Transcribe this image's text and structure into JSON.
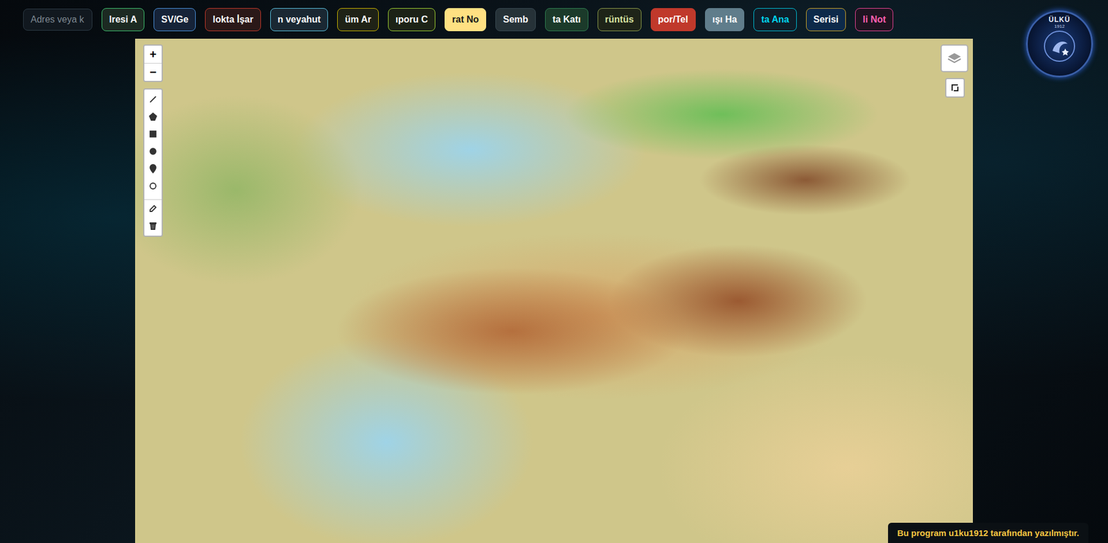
{
  "search": {
    "placeholder": "Adres veya k"
  },
  "toolbar_buttons": [
    {
      "label": "lresi A",
      "bg": "#1c2a22",
      "border": "#3fbf6f",
      "text": "#ffffff"
    },
    {
      "label": "SV/Ge",
      "bg": "#162338",
      "border": "#4a90d9",
      "text": "#ffffff"
    },
    {
      "label": "lokta İşar",
      "bg": "#2a1818",
      "border": "#c0392b",
      "text": "#ffffff"
    },
    {
      "label": "n veyahut",
      "bg": "#1a2833",
      "border": "#5bc0de",
      "text": "#ffffff"
    },
    {
      "label": "üm Ar",
      "bg": "#1f2216",
      "border": "#c8b400",
      "text": "#ffffff"
    },
    {
      "label": "ıporu C",
      "bg": "#1c2216",
      "border": "#9acd32",
      "text": "#ffffff"
    },
    {
      "label": "rat No",
      "bg": "#ffe082",
      "border": "#ffe082",
      "text": "#1a1a1a"
    },
    {
      "label": "Semb",
      "bg": "#263238",
      "border": "#37474f",
      "text": "#ffffff"
    },
    {
      "label": "ta Katı",
      "bg": "#1b3a2a",
      "border": "#2e7d4f",
      "text": "#ffffff"
    },
    {
      "label": "rüntüs",
      "bg": "#1e2418",
      "border": "#8a9a4a",
      "text": "#d6e0a0"
    },
    {
      "label": "por/Tel",
      "bg": "#c0392b",
      "border": "#c0392b",
      "text": "#ffffff"
    },
    {
      "label": "ışı Ha",
      "bg": "#607d8b",
      "border": "#607d8b",
      "text": "#ffffff"
    },
    {
      "label": "ta Ana",
      "bg": "#0f1d28",
      "border": "#00bcd4",
      "text": "#00d4ee"
    },
    {
      "label": "Serisi",
      "bg": "#0d2a4a",
      "border": "#c9a227",
      "text": "#ffffff"
    },
    {
      "label": "li Not",
      "bg": "#1e1420",
      "border": "#e84393",
      "text": "#ff5fb0"
    }
  ],
  "logo": {
    "title": "ÜLKÜ",
    "year": "1912"
  },
  "map_controls": {
    "zoom_in": "+",
    "zoom_out": "−"
  },
  "footer_toast": "Bu program u1ku1912 tarafından yazılmıştır."
}
